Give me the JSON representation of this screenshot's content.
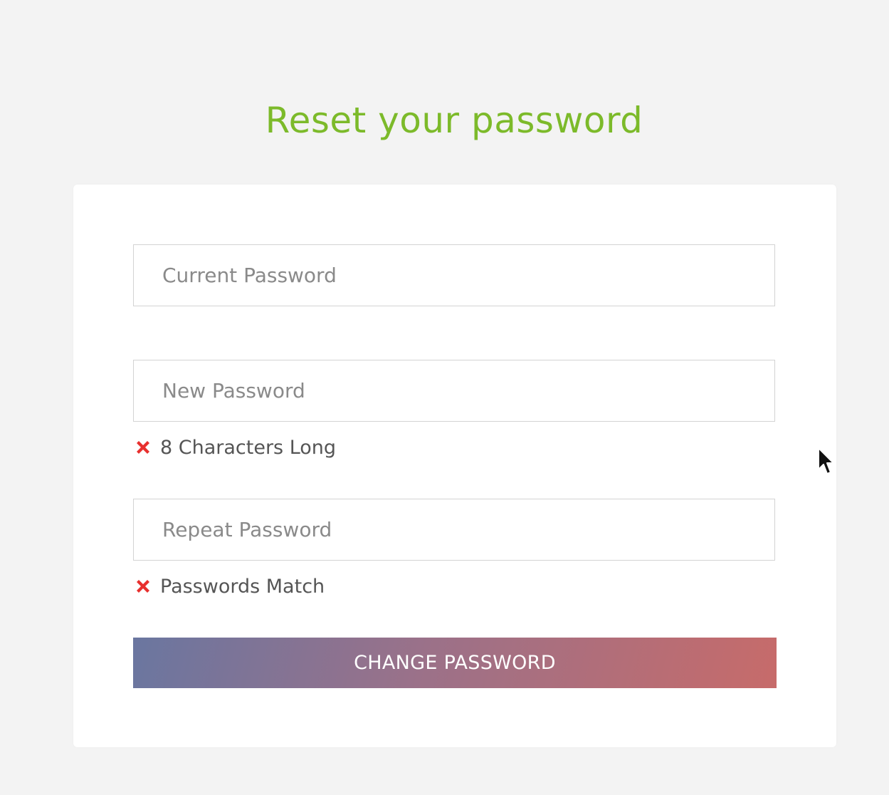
{
  "page": {
    "title": "Reset your password"
  },
  "form": {
    "current_password_placeholder": "Current Password",
    "new_password_placeholder": "New Password",
    "repeat_password_placeholder": "Repeat Password",
    "rules": {
      "length": {
        "label": "8 Characters Long",
        "satisfied": false,
        "icon": "x-mark-icon"
      },
      "match": {
        "label": "Passwords Match",
        "satisfied": false,
        "icon": "x-mark-icon"
      }
    },
    "submit_label": "CHANGE PASSWORD"
  },
  "colors": {
    "title": "#7cba2a",
    "error_icon": "#e8302e",
    "button_gradient_start": "#6a76a0",
    "button_gradient_end": "#c76b6a",
    "background": "#f3f3f3",
    "card": "#ffffff"
  },
  "cursor": {
    "icon": "mouse-pointer-icon"
  }
}
